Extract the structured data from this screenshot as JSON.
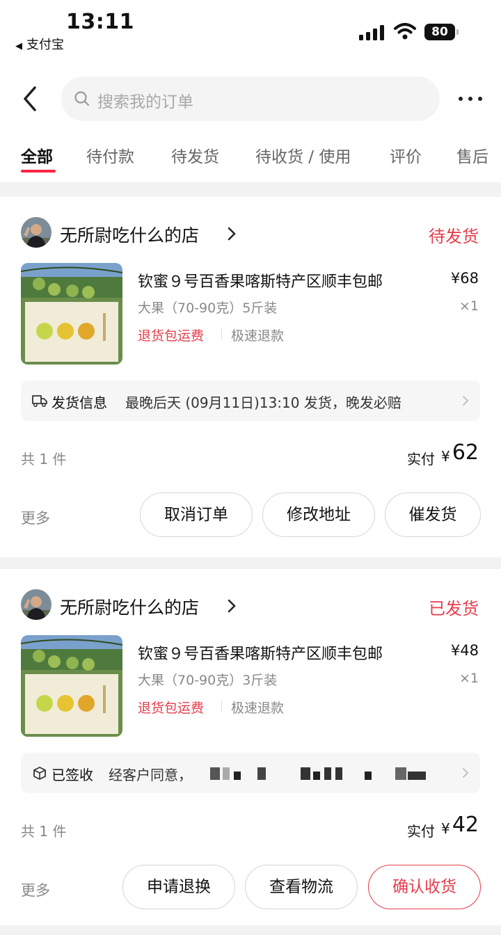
{
  "status_bar": {
    "time": "13:11",
    "back_app": "支付宝",
    "battery": "80"
  },
  "header": {
    "search_placeholder": "搜索我的订单"
  },
  "tabs": [
    {
      "label": "全部",
      "active": true
    },
    {
      "label": "待付款"
    },
    {
      "label": "待发货"
    },
    {
      "label": "待收货 / 使用"
    },
    {
      "label": "评价"
    },
    {
      "label": "售后"
    }
  ],
  "orders": [
    {
      "shop_name": "无所尉吃什么的店",
      "status": "待发货",
      "title": "钦蜜９号百香果喀斯特产区顺丰包邮",
      "price": "¥68",
      "spec": "大果（70-90克）5斤装",
      "qty": "×1",
      "tag_red": "退货包运费",
      "tag_gray": "极速退款",
      "info_label": "发货信息",
      "info_text": "最晚后天 (09月11日)13:10 发货，晚发必赔",
      "count": "共 1 件",
      "paid_label": "实付",
      "paid_yen": "¥",
      "paid_amount": "62",
      "more": "更多",
      "buttons": [
        "取消订单",
        "修改地址",
        "催发货"
      ]
    },
    {
      "shop_name": "无所尉吃什么的店",
      "status": "已发货",
      "title": "钦蜜９号百香果喀斯特产区顺丰包邮",
      "price": "¥48",
      "spec": "大果（70-90克）3斤装",
      "qty": "×1",
      "tag_red": "退货包运费",
      "tag_gray": "极速退款",
      "info_label": "已签收",
      "info_text": "经客户同意，",
      "count": "共 1 件",
      "paid_label": "实付",
      "paid_yen": "¥",
      "paid_amount": "42",
      "more": "更多",
      "buttons": [
        "申请退换",
        "查看物流",
        "确认收货"
      ]
    }
  ],
  "colors": {
    "accent_red": "#e63c4b",
    "tab_indicator": "#ff2442"
  }
}
